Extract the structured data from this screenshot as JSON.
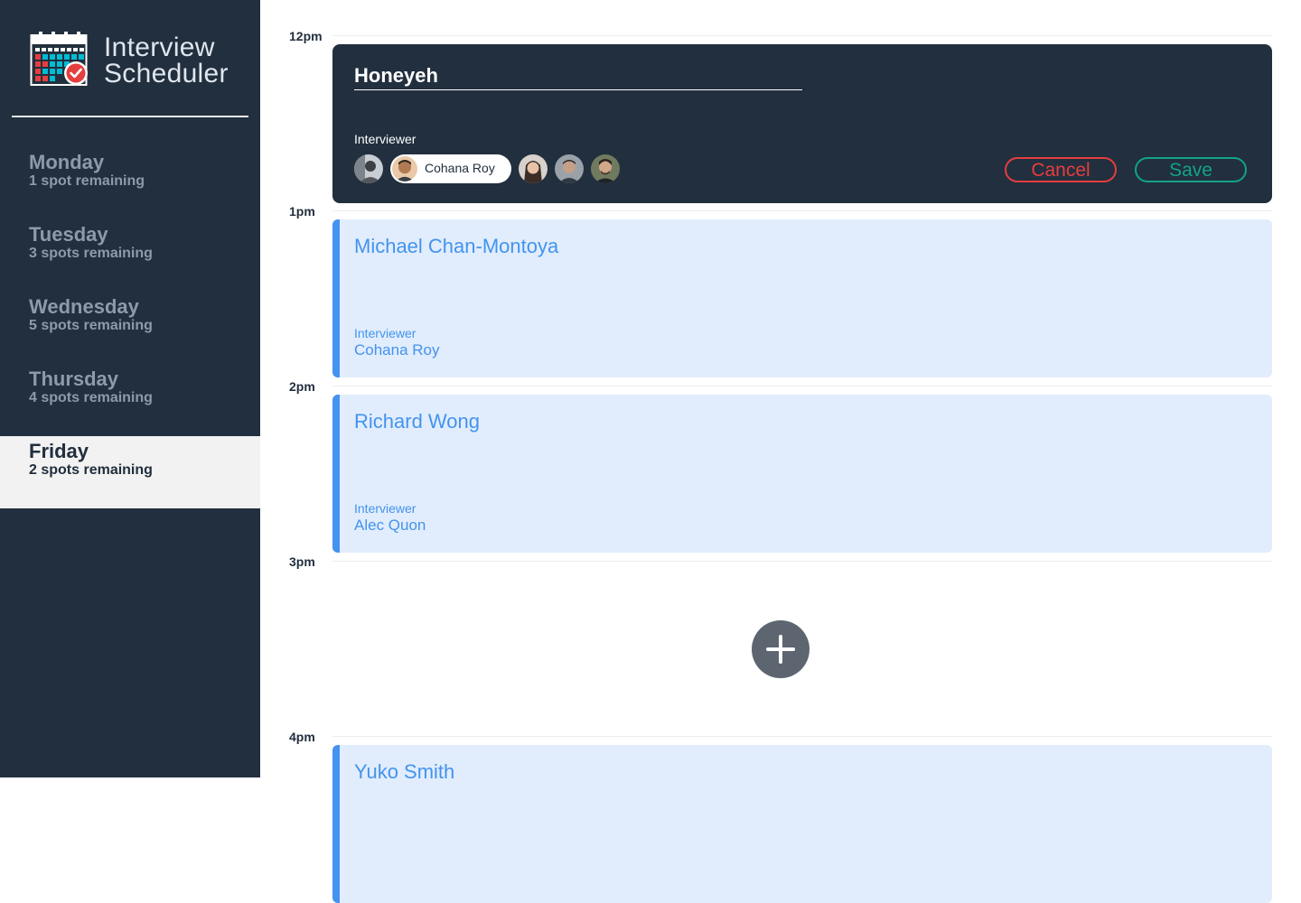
{
  "brand": {
    "line1": "Interview",
    "line2": "Scheduler"
  },
  "days": [
    {
      "name": "Monday",
      "spots": "1 spot remaining"
    },
    {
      "name": "Tuesday",
      "spots": "3 spots remaining"
    },
    {
      "name": "Wednesday",
      "spots": "5 spots remaining"
    },
    {
      "name": "Thursday",
      "spots": "4 spots remaining"
    },
    {
      "name": "Friday",
      "spots": "2 spots remaining",
      "selected": true
    }
  ],
  "times": [
    "12pm",
    "1pm",
    "2pm",
    "3pm",
    "4pm"
  ],
  "form": {
    "student_value": "Honeyeh",
    "interviewer_label": "Interviewer",
    "selected_interviewer": "Cohana Roy",
    "cancel_label": "Cancel",
    "save_label": "Save"
  },
  "appointments": [
    {
      "student": "Michael Chan-Montoya",
      "interviewer_label": "Interviewer",
      "interviewer": "Cohana Roy"
    },
    {
      "student": "Richard Wong",
      "interviewer_label": "Interviewer",
      "interviewer": "Alec Quon"
    },
    {
      "student": "Yuko Smith"
    }
  ],
  "colors": {
    "sidebar": "#222f3e",
    "accent_blue": "#4493ee",
    "appointment_bg": "#e1edfc",
    "cancel": "#e53e3e",
    "save": "#12a386"
  }
}
